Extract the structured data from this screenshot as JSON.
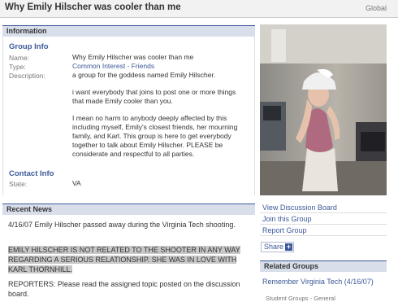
{
  "header": {
    "title": "Why Emily Hilscher was cooler than me",
    "scope": "Global"
  },
  "information": {
    "heading": "Information",
    "group_info_title": "Group Info",
    "name_label": "Name:",
    "name_value": "Why Emily Hilscher was cooler than me",
    "type_label": "Type:",
    "type_value": "Common Interest - Friends",
    "description_label": "Description:",
    "description_p1": "a group for the goddess named Emily Hilscher.",
    "description_p2": "i want everybody that joins to post one or more things that made Emily cooler than you.",
    "description_p3": "I mean no harm to anybody deeply affected by this including myself, Emily's closest friends, her mourning family, and Karl. This group is here to get everybody together to talk about Emily Hilscher. PLEASE be considerate and respectful to all parties.",
    "contact_info_title": "Contact Info",
    "state_label": "State:",
    "state_value": "VA"
  },
  "recent_news": {
    "heading": "Recent News",
    "p1": "4/16/07 Emily Hilscher passed away during the Virginia Tech shooting.",
    "p2": "EMILY HILSCHER IS NOT RELATED TO THE SHOOTER IN ANY WAY REGARDING A SERIOUS RELATIONSHIP. SHE WAS IN LOVE WITH KARL THORNHILL.",
    "p3": "REPORTERS: Please read the assigned topic posted on the discussion board."
  },
  "sidebar": {
    "links": [
      "View Discussion Board",
      "Join this Group",
      "Report Group"
    ],
    "share_label": "Share",
    "share_plus": "+",
    "related_heading": "Related Groups",
    "related_group_name": "Remember Virginia Tech (4/16/07)",
    "related_group_meta": "Student Groups - General"
  },
  "colors": {
    "brand_blue": "#3b5998",
    "header_band": "#d8dfea",
    "highlight": "#c8c8c8"
  }
}
